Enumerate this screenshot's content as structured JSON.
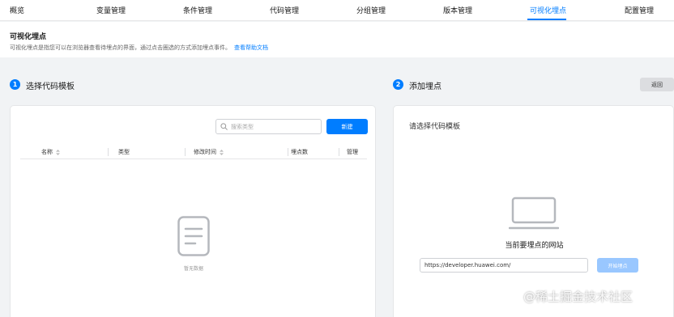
{
  "tabs": [
    {
      "label": "概览"
    },
    {
      "label": "变量管理"
    },
    {
      "label": "条件管理"
    },
    {
      "label": "代码管理"
    },
    {
      "label": "分组管理"
    },
    {
      "label": "版本管理"
    },
    {
      "label": "可视化埋点",
      "active": true
    },
    {
      "label": "配置管理"
    }
  ],
  "intro": {
    "title": "可视化埋点",
    "description": "可视化埋点是指您可以在浏览器查看待埋点的界面，通过点击圈选的方式添加埋点事件。",
    "help_link": "查看帮助文档"
  },
  "step1": {
    "number": "1",
    "title": "选择代码模板"
  },
  "step2": {
    "number": "2",
    "title": "添加埋点"
  },
  "back_button": "返回",
  "template_panel": {
    "search_placeholder": "搜索类型",
    "new_button": "新建",
    "columns": [
      "名称",
      "类型",
      "修改时间",
      "埋点数",
      "管理"
    ],
    "empty_text": "暂无数据"
  },
  "add_panel": {
    "title": "请选择代码模板",
    "site_label": "当前要埋点的网站",
    "url_value": "https://developer.huawei.com/",
    "start_button": "开始埋点"
  },
  "watermark": "@稀土掘金技术社区",
  "colors": {
    "accent": "#007dff",
    "disabled_accent": "#99c7ff"
  }
}
